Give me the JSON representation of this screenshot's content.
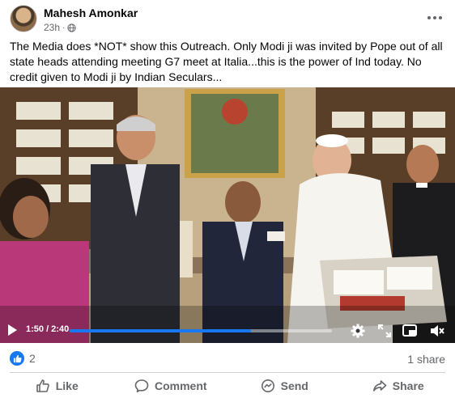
{
  "post": {
    "author": "Mahesh Amonkar",
    "timestamp": "23h",
    "separator": "·",
    "privacy_icon": "globe-icon",
    "caption": "The Media does *NOT* show this Outreach. Only Modi ji was invited by Pope out of all state heads attending meeting G7 meet at Italia...this is the power of Ind  today. No credit given to Modi ji by Indian Seculars..."
  },
  "video": {
    "time_display": "1:50 / 2:40",
    "progress": 0.69,
    "controls": [
      "play-icon",
      "settings-icon",
      "fullscreen-icon",
      "pip-icon",
      "mute-icon"
    ]
  },
  "engagement": {
    "reaction_count": "2",
    "share_count": "1 share"
  },
  "actions": {
    "like": "Like",
    "comment": "Comment",
    "send": "Send",
    "share": "Share"
  },
  "colors": {
    "accent": "#1877f2",
    "secondary_text": "#65676b"
  }
}
